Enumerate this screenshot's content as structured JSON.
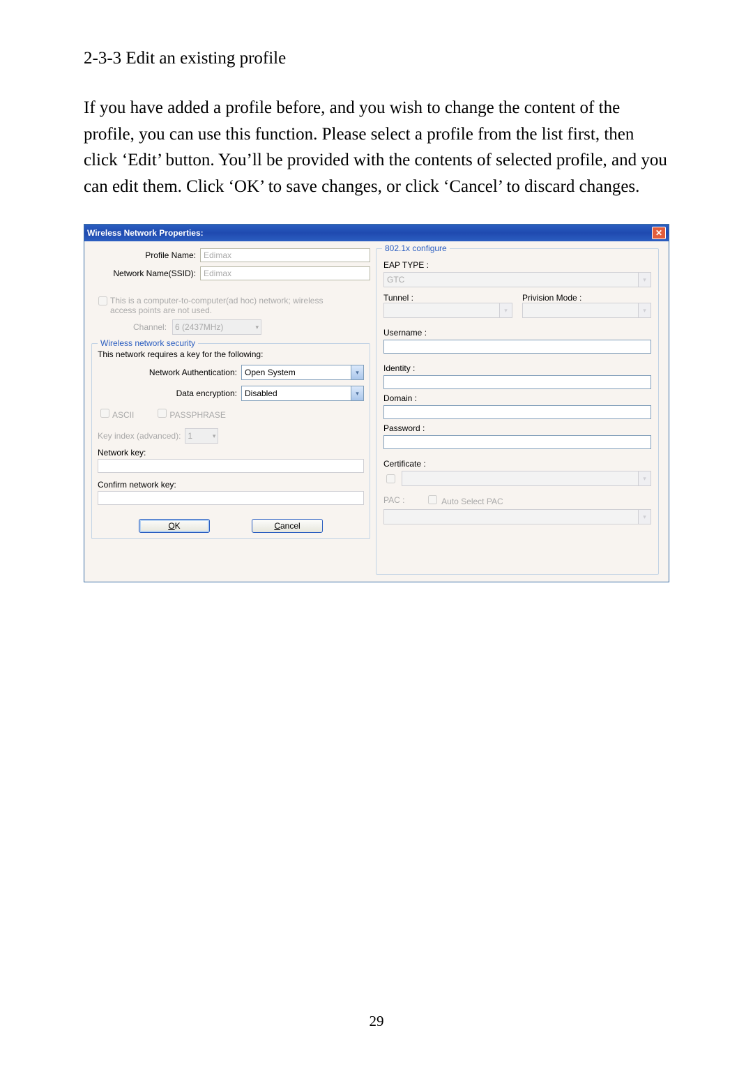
{
  "doc": {
    "heading": "2-3-3 Edit an existing profile",
    "body": "If you have added a profile before, and you wish to change the content of the profile, you can use this function. Please select a profile from the list first, then click ‘Edit’ button. You’ll be provided with the contents of selected profile, and you can edit them. Click ‘OK’ to save changes, or click ‘Cancel’ to discard changes.",
    "page_number": "29"
  },
  "dlg": {
    "title": "Wireless Network Properties:",
    "profile_name_label": "Profile Name:",
    "profile_name_value": "Edimax",
    "ssid_label": "Network Name(SSID):",
    "ssid_value": "Edimax",
    "adhoc_text_1": "This is a computer-to-computer(ad hoc) network; wireless",
    "adhoc_text_2": "access points are not used.",
    "channel_label": "Channel:",
    "channel_value": "6  (2437MHz)",
    "sec_group_title": "Wireless network security",
    "sec_desc": "This network requires a key for the following:",
    "auth_label": "Network Authentication:",
    "auth_value": "Open System",
    "enc_label": "Data encryption:",
    "enc_value": "Disabled",
    "ascii_label": "ASCII",
    "passphrase_label": "PASSPHRASE",
    "keyidx_label": "Key index (advanced):",
    "keyidx_value": "1",
    "netkey_label": "Network key:",
    "confirm_label": "Confirm network key:",
    "ok": "OK",
    "cancel": "Cancel",
    "cfg_group": "802.1x configure",
    "eap_label": "EAP TYPE :",
    "eap_value": "GTC",
    "tunnel_label": "Tunnel :",
    "privision_label": "Privision Mode :",
    "username_label": "Username :",
    "identity_label": "Identity :",
    "domain_label": "Domain :",
    "password_label": "Password :",
    "cert_label": "Certificate :",
    "pac_label": "PAC :",
    "auto_pac": "Auto Select PAC"
  }
}
